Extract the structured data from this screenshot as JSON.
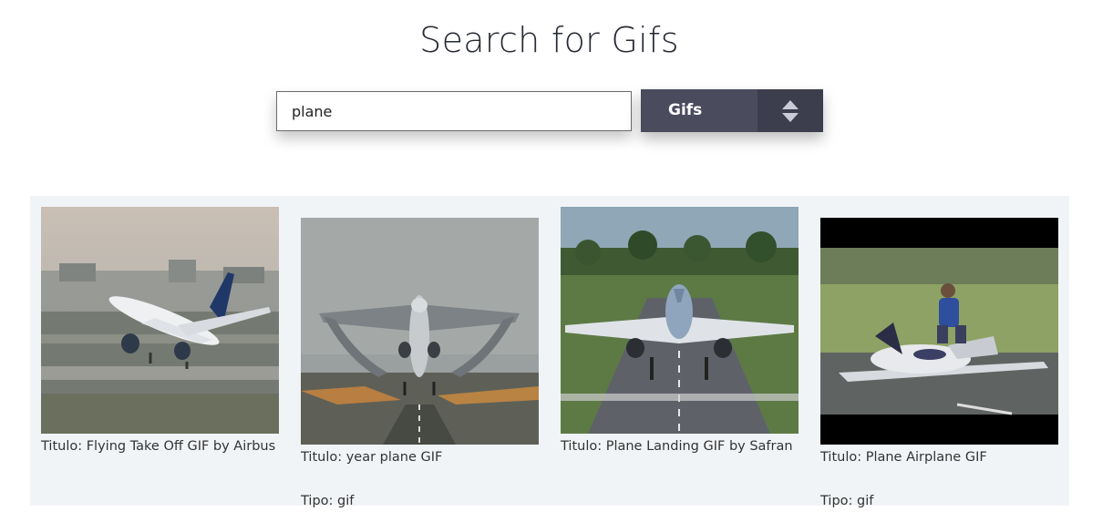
{
  "header": {
    "title": "Search for Gifs"
  },
  "search": {
    "value": "plane",
    "placeholder": ""
  },
  "type_select": {
    "selected": "Gifs"
  },
  "results": [
    {
      "caption": "Titulo: Flying Take Off GIF by Airbus",
      "type": ""
    },
    {
      "caption": "Titulo: year plane GIF",
      "type": "Tipo: gif"
    },
    {
      "caption": "Titulo: Plane Landing GIF by Safran",
      "type": ""
    },
    {
      "caption": "Titulo: Plane Airplane GIF",
      "type": "Tipo: gif"
    }
  ]
}
